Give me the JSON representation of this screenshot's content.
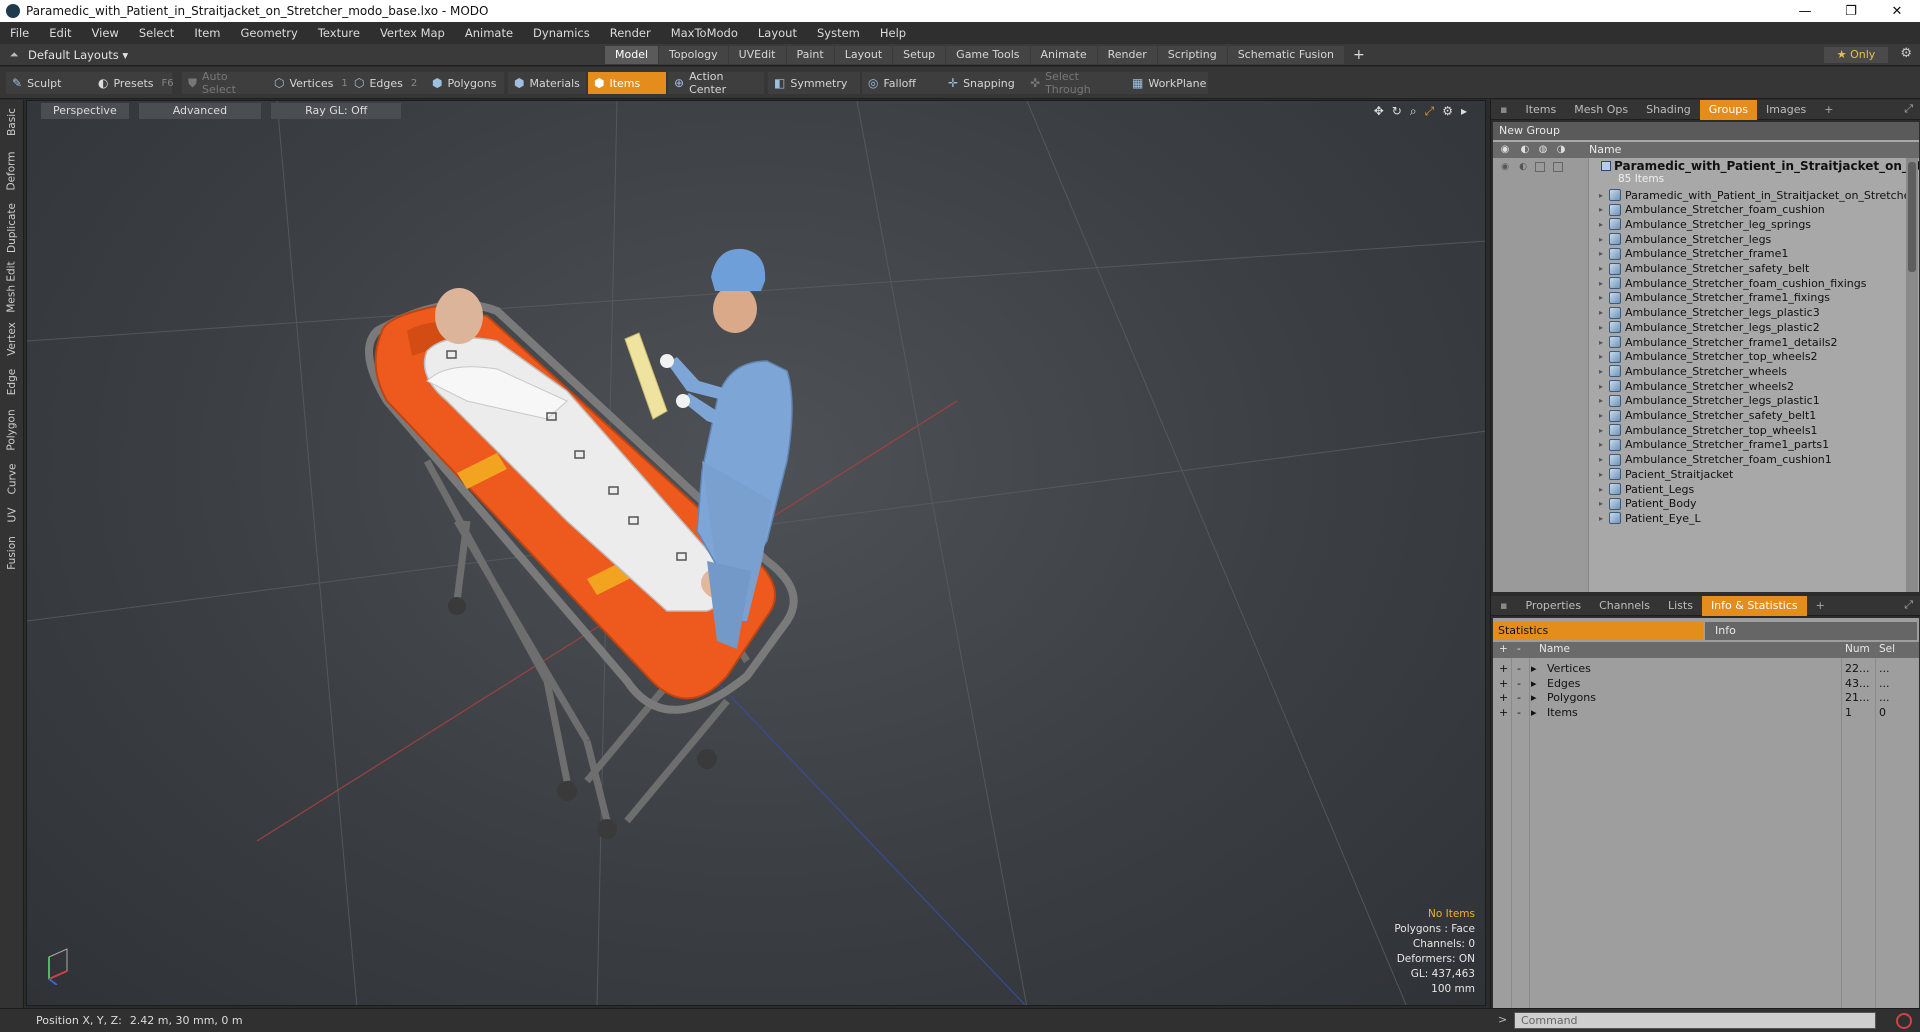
{
  "window": {
    "title": "Paramedic_with_Patient_in_Straitjacket_on_Stretcher_modo_base.lxo - MODO",
    "minimize": "—",
    "maximize": "❐",
    "close": "✕"
  },
  "menu": [
    "File",
    "Edit",
    "View",
    "Select",
    "Item",
    "Geometry",
    "Texture",
    "Vertex Map",
    "Animate",
    "Dynamics",
    "Render",
    "MaxToModo",
    "Layout",
    "System",
    "Help"
  ],
  "layout": {
    "name": "Default Layouts ▾",
    "tabs": [
      "Model",
      "Topology",
      "UVEdit",
      "Paint",
      "Layout",
      "Setup",
      "Game Tools",
      "Animate",
      "Render",
      "Scripting",
      "Schematic Fusion"
    ],
    "active_tab": "Model",
    "add_tab": "+",
    "only_label": "★  Only"
  },
  "toolbar": {
    "sculpt": "Sculpt",
    "presets": "Presets",
    "presets_key": "F6",
    "auto_select": "Auto Select",
    "vertices": "Vertices",
    "vertices_key": "1",
    "edges": "Edges",
    "edges_key": "2",
    "polygons": "Polygons",
    "materials": "Materials",
    "items": "Items",
    "action_center": "Action Center",
    "symmetry": "Symmetry",
    "falloff": "Falloff",
    "snapping": "Snapping",
    "select_through": "Select Through",
    "workplane": "WorkPlane"
  },
  "side_tabs": [
    "Basic",
    "Deform",
    "Duplicate",
    "Mesh Edit",
    "Vertex",
    "Edge",
    "Polygon",
    "Curve",
    "UV",
    "Fusion"
  ],
  "viewport": {
    "view": "Perspective",
    "shading": "Advanced",
    "raygl": "Ray GL: Off",
    "info": {
      "header": "No Items",
      "polygons": "Polygons : Face",
      "channels": "Channels: 0",
      "deformers": "Deformers: ON",
      "gl": "GL: 437,463",
      "scale": "100 mm"
    }
  },
  "status": {
    "label": "Position X, Y, Z:",
    "value": "2.42 m, 30 mm, 0 m"
  },
  "top_panel": {
    "tabs": [
      "Items",
      "Mesh Ops",
      "Shading",
      "Groups",
      "Images"
    ],
    "active_tab": "Groups",
    "new_group": "New Group",
    "name_col": "Name",
    "root_title": "Paramedic_with_Patient_in_Straitjacket_on_St...",
    "root_count": "85 Items",
    "items": [
      "Paramedic_with_Patient_in_Straitjacket_on_Stretcher",
      "Ambulance_Stretcher_foam_cushion",
      "Ambulance_Stretcher_leg_springs",
      "Ambulance_Stretcher_legs",
      "Ambulance_Stretcher_frame1",
      "Ambulance_Stretcher_safety_belt",
      "Ambulance_Stretcher_foam_cushion_fixings",
      "Ambulance_Stretcher_frame1_fixings",
      "Ambulance_Stretcher_legs_plastic3",
      "Ambulance_Stretcher_legs_plastic2",
      "Ambulance_Stretcher_frame1_details2",
      "Ambulance_Stretcher_top_wheels2",
      "Ambulance_Stretcher_wheels",
      "Ambulance_Stretcher_wheels2",
      "Ambulance_Stretcher_legs_plastic1",
      "Ambulance_Stretcher_safety_belt1",
      "Ambulance_Stretcher_top_wheels1",
      "Ambulance_Stretcher_frame1_parts1",
      "Ambulance_Stretcher_foam_cushion1",
      "Pacient_Straitjacket",
      "Patient_Legs",
      "Patient_Body",
      "Patient_Eye_L"
    ]
  },
  "bottom_panel": {
    "tabs": [
      "Properties",
      "Channels",
      "Lists",
      "Info & Statistics"
    ],
    "active_tab": "Info & Statistics",
    "statistics": "Statistics",
    "info": "Info",
    "cols": {
      "name": "Name",
      "num": "Num",
      "sel": "Sel"
    },
    "rows": [
      {
        "name": "Vertices",
        "num": "22...",
        "sel": "..."
      },
      {
        "name": "Edges",
        "num": "43...",
        "sel": "..."
      },
      {
        "name": "Polygons",
        "num": "21...",
        "sel": "..."
      },
      {
        "name": "Items",
        "num": "1",
        "sel": "0"
      }
    ]
  },
  "command": {
    "placeholder": "Command",
    "prompt": ">"
  },
  "colors": {
    "accent": "#e48c1c",
    "stretcher": "#ee5a1e",
    "scrubs": "#7da5d6",
    "jacket": "#eeeeee"
  }
}
